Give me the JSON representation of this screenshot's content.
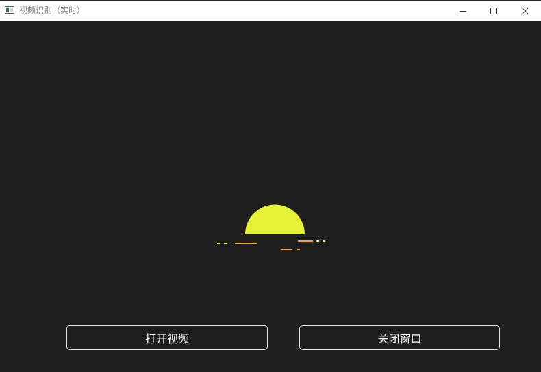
{
  "window": {
    "title": "视频识别（实时）",
    "controls": {
      "minimize_icon": "minimize-icon",
      "maximize_icon": "maximize-icon",
      "close_icon": "close-icon"
    }
  },
  "illustration": {
    "name": "sunset-icon",
    "sun_color": "#e6f235",
    "line_color": "#f0a82a"
  },
  "actions": {
    "open_video_label": "打开视频",
    "close_window_label": "关闭窗口"
  },
  "colors": {
    "background": "#1e1e1e",
    "titlebar": "#ffffff",
    "button_border": "#e8e8e8",
    "button_text": "#ffffff"
  }
}
